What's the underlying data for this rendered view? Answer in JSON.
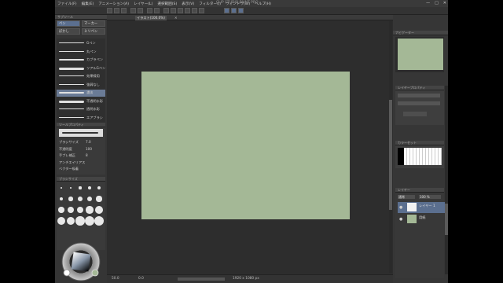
{
  "window": {
    "title": "CLIP STUDIO PAINT PRO",
    "controls": [
      "—",
      "□",
      "✕"
    ]
  },
  "menu": [
    "ファイル(F)",
    "編集(E)",
    "アニメーション(A)",
    "レイヤー(L)",
    "選択範囲(S)",
    "表示(V)",
    "フィルター(I)",
    "ウィンドウ(W)",
    "ヘルプ(H)"
  ],
  "left": {
    "subtool_header": "サブツール",
    "subtabs": [
      "ペン",
      "マーカー",
      "ぼかし",
      "ミリペン"
    ],
    "brushes": [
      "Gペン",
      "丸ペン",
      "カブラペン",
      "リアルGペン",
      "効果線用",
      "強弱なし",
      "濃淡",
      "不透明水彩",
      "透明水彩",
      "エアブラシ"
    ],
    "selected_brush_index": 6,
    "tool_property_header": "ツールプロパティ",
    "props": [
      {
        "label": "ブラシサイズ",
        "value": "7.0"
      },
      {
        "label": "不透明度",
        "value": "100"
      },
      {
        "label": "手ブレ補正",
        "value": "8"
      },
      {
        "label": "アンチエイリアス",
        "value": ""
      },
      {
        "label": "ベクター吸着",
        "value": ""
      }
    ],
    "brush_size_header": "ブラシサイズ",
    "size_values": [
      "0.7",
      "1",
      "1.5",
      "2",
      "2.5",
      "3",
      "4",
      "5",
      "6",
      "7",
      "8",
      "10",
      "12",
      "15",
      "17",
      "20",
      "25",
      "30",
      "40",
      "50"
    ]
  },
  "canvas": {
    "tab_label": "イラスト(100.0%)",
    "tab_close": "✕",
    "paper_color": "#a4b896"
  },
  "status": {
    "zoom": "50.0",
    "angle": "0.0",
    "size": "1920 x 1080 px"
  },
  "right": {
    "navigator_header": "ナビゲーター",
    "layer_prop_header": "レイヤープロパティ",
    "color_set_header": "カラーセット",
    "layer_header": "レイヤー",
    "layers": [
      {
        "name": "レイヤー 1",
        "color": "#f2f2f2",
        "selected": true
      },
      {
        "name": "用紙",
        "color": "#a4b896",
        "selected": false
      }
    ],
    "blend_mode": "通常",
    "opacity": "100 %"
  }
}
